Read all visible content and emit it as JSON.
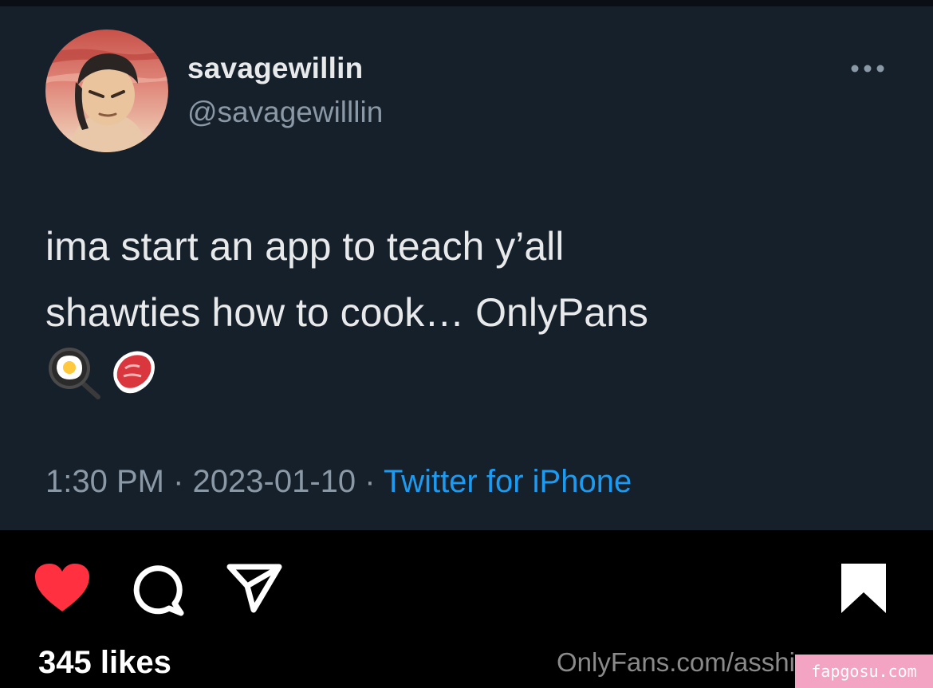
{
  "tweet": {
    "display_name": "savagewillin",
    "handle": "@savagewilllin",
    "text_lines": [
      "ima start an app to teach y’all",
      "shawties how to cook… OnlyPans"
    ],
    "emojis": [
      "frying-pan-egg",
      "cut-of-meat"
    ],
    "time": "1:30 PM",
    "separator": " · ",
    "date": "2023-01-10",
    "source": "Twitter for iPhone",
    "more_icon": "more-dots-icon"
  },
  "post": {
    "likes": "345 likes",
    "watermark": "OnlyFans.com/asshi",
    "site_badge": "fapgosu.com",
    "icons": [
      "heart-icon",
      "comment-icon",
      "share-icon",
      "bookmark-icon"
    ]
  },
  "colors": {
    "tweet_bg": "#15202b",
    "text_primary": "#e7e9ea",
    "text_secondary": "#8b98a5",
    "link_blue": "#1d9bf0",
    "like_red": "#ff3040",
    "badge_pink": "#f2a4c2"
  }
}
